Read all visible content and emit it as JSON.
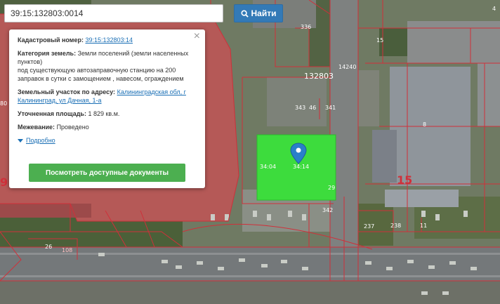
{
  "search": {
    "value": "39:15:132803:0014",
    "button_label": "Найти"
  },
  "popup": {
    "cadastral_label": "Кадастровый номер:",
    "cadastral_value": "39:15:132803:14",
    "category_label": "Категория земель:",
    "category_value": "Земли поселений (земли населенных пунктов)",
    "purpose_value": "под существующую автозаправочную станцию на 200 заправок в сутки с замощением , навесом, ограждением",
    "address_label": "Земельный участок по адресу:",
    "address_value": "Калининградская обл, г Калининград, ул Дачная, 1-а",
    "area_label": "Уточненная площадь:",
    "area_value": "1 829 кв.м.",
    "survey_label": "Межевание:",
    "survey_value": "Проведено",
    "more_label": "Подробно",
    "docs_button_label": "Посмотреть доступные документы",
    "close_label": "×"
  },
  "map_labels": {
    "block": "132803",
    "lots": [
      "336",
      "15",
      "14240",
      "343",
      "46",
      "341",
      "8",
      "15",
      "34:14",
      "34:04",
      "29",
      "342",
      "237",
      "238",
      "11",
      "26",
      "108",
      "9",
      "80",
      "4"
    ]
  },
  "colors": {
    "accent": "#337ab7",
    "parcel_fill": "#3ddc3d",
    "boundary": "#d0303a",
    "docs_button": "#4caf50",
    "marker": "#2a7fc9"
  },
  "icons": {
    "search": "search-icon",
    "marker": "map-marker-icon",
    "close": "close-icon",
    "expand": "triangle-down-icon"
  }
}
